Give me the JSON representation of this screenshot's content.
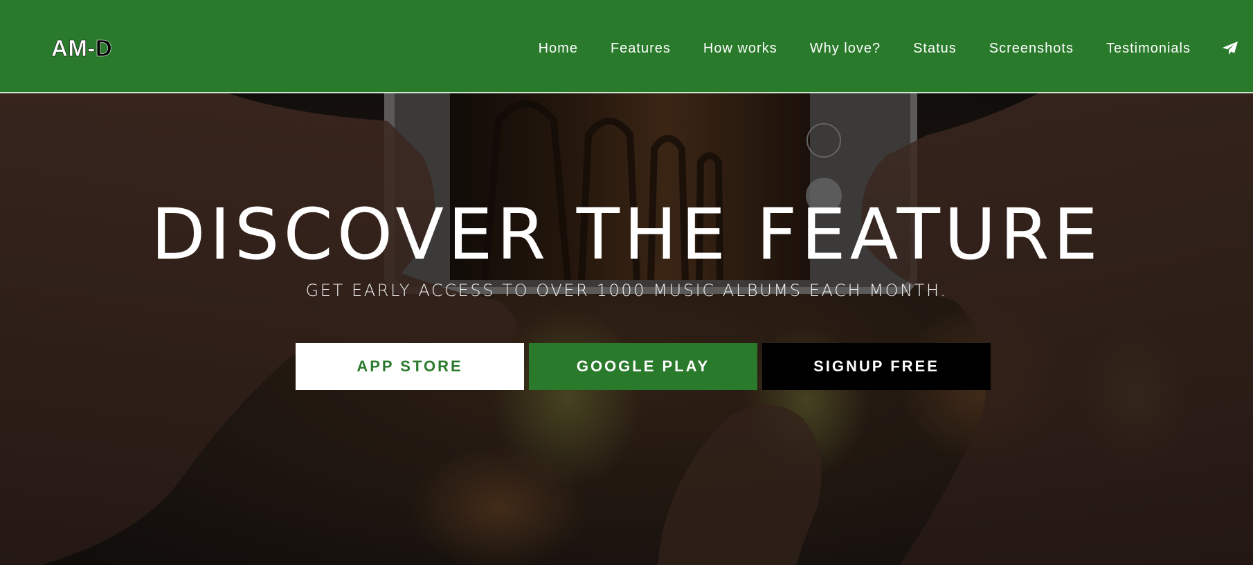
{
  "brand": {
    "logo_main": "AM-",
    "logo_accent": "D",
    "primary_color": "#2a7a2c"
  },
  "nav": {
    "items": [
      {
        "label": "Home"
      },
      {
        "label": "Features"
      },
      {
        "label": "How works"
      },
      {
        "label": "Why love?"
      },
      {
        "label": "Status"
      },
      {
        "label": "Screenshots"
      },
      {
        "label": "Testimonials"
      }
    ],
    "icon": "paper-plane-icon"
  },
  "hero": {
    "title": "DISCOVER THE FEATURE",
    "subtitle": "GET EARLY ACCESS TO OVER 1000 MUSIC ALBUMS EACH MONTH.",
    "background": "hands-holding-phone-photo",
    "buttons": {
      "app_store": "APP STORE",
      "google_play": "GOOGLE PLAY",
      "signup": "SIGNUP FREE"
    }
  }
}
